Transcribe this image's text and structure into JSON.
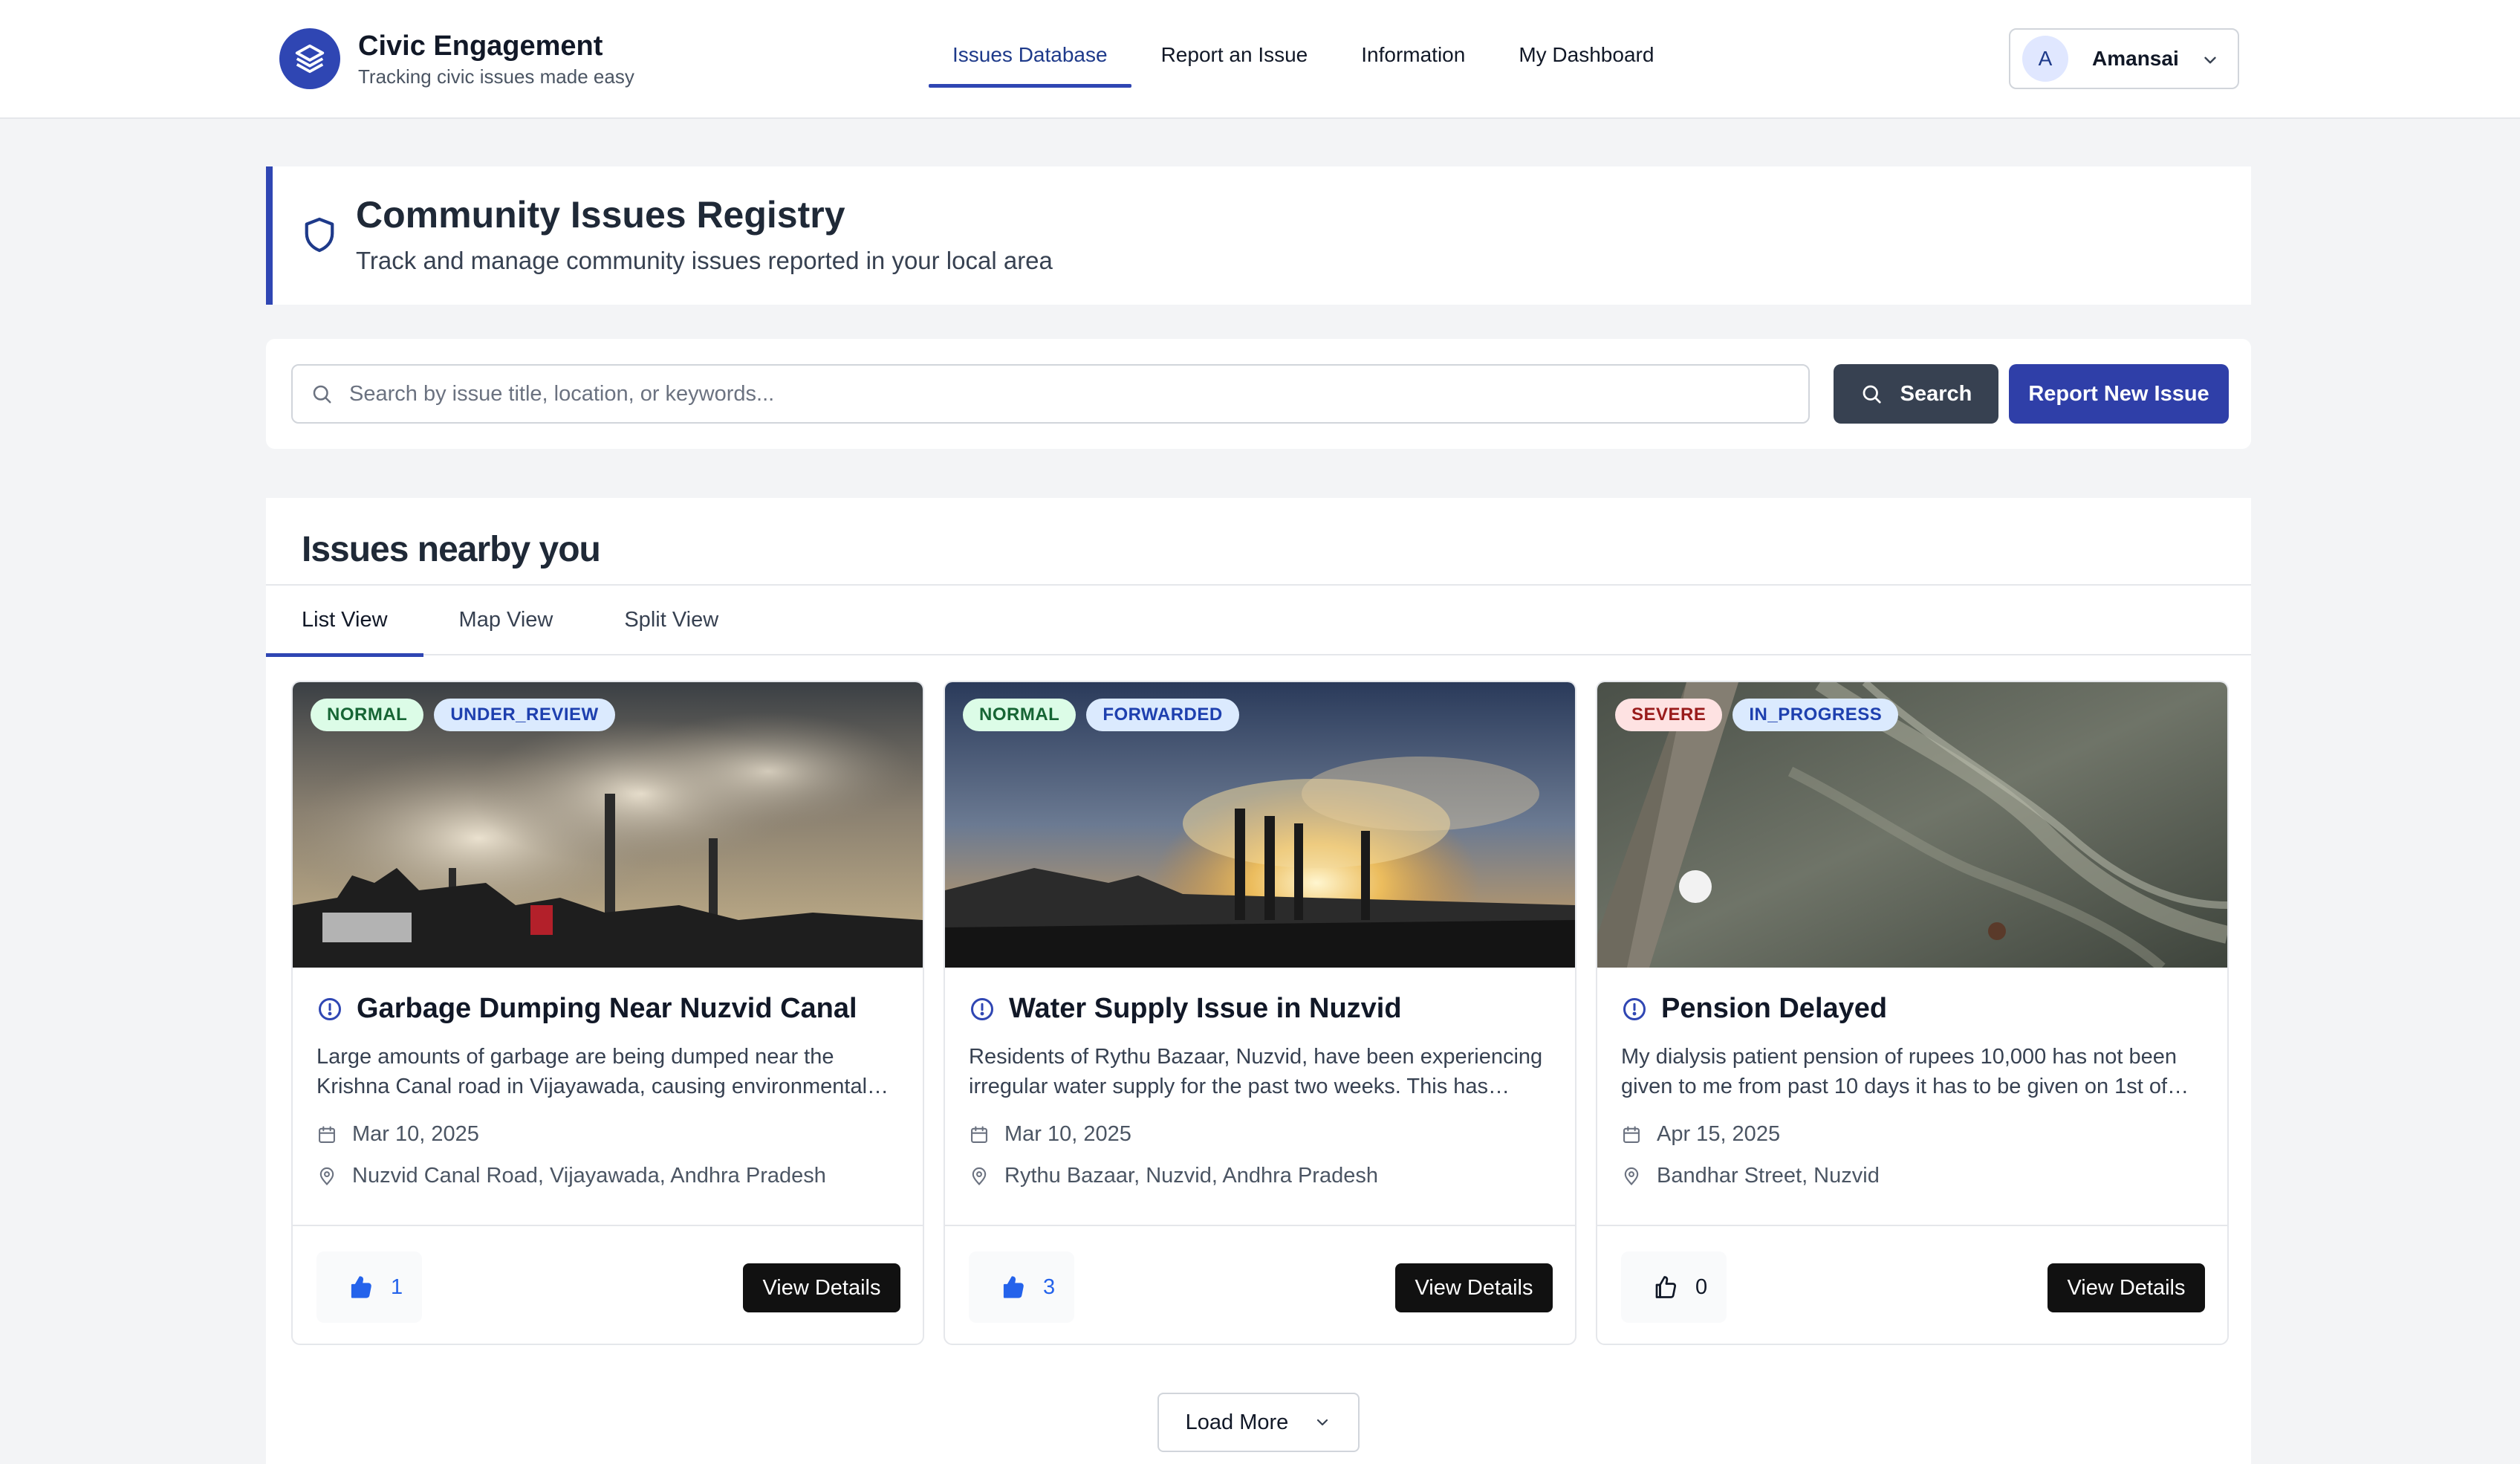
{
  "app": {
    "title": "Civic Engagement",
    "subtitle": "Tracking civic issues made easy"
  },
  "nav": {
    "items": [
      {
        "label": "Issues Database",
        "active": true
      },
      {
        "label": "Report an Issue",
        "active": false
      },
      {
        "label": "Information",
        "active": false
      },
      {
        "label": "My Dashboard",
        "active": false
      }
    ]
  },
  "user": {
    "initial": "A",
    "name": "Amansai"
  },
  "banner": {
    "title": "Community Issues Registry",
    "subtitle": "Track and manage community issues reported in your local area"
  },
  "search": {
    "placeholder": "Search by issue title, location, or keywords...",
    "value": "",
    "search_label": "Search",
    "report_label": "Report New Issue"
  },
  "issues": {
    "heading": "Issues nearby you",
    "tabs": [
      {
        "label": "List View",
        "active": true
      },
      {
        "label": "Map View",
        "active": false
      },
      {
        "label": "Split View",
        "active": false
      }
    ],
    "cards": [
      {
        "severity": "NORMAL",
        "status": "UNDER_REVIEW",
        "title": "Garbage Dumping Near Nuzvid Canal",
        "description": "Large amounts of garbage are being dumped near the Krishna Canal road in Vijayawada, causing environmental…",
        "date": "Mar 10, 2025",
        "location": "Nuzvid Canal Road, Vijayawada, Andhra Pradesh",
        "upvotes": "1",
        "details_label": "View Details"
      },
      {
        "severity": "NORMAL",
        "status": "FORWARDED",
        "title": "Water Supply Issue in Nuzvid",
        "description": "Residents of Rythu Bazaar, Nuzvid, have been experiencing irregular water supply for the past two weeks. This has…",
        "date": "Mar 10, 2025",
        "location": "Rythu Bazaar, Nuzvid, Andhra Pradesh",
        "upvotes": "3",
        "details_label": "View Details"
      },
      {
        "severity": "SEVERE",
        "status": "IN_PROGRESS",
        "title": "Pension Delayed",
        "description": "My dialysis patient pension of rupees 10,000 has not been given to me from past 10 days it has to be given on 1st of…",
        "date": "Apr 15, 2025",
        "location": "Bandhar Street, Nuzvid",
        "upvotes": "0",
        "details_label": "View Details"
      }
    ],
    "load_more_label": "Load More"
  },
  "colors": {
    "brand": "#2f46b3",
    "report_button": "#2f3fa8",
    "search_button": "#374151",
    "badge_normal": "#dcfce7",
    "badge_severe": "#fee2e2",
    "badge_status": "#dbeafe"
  }
}
